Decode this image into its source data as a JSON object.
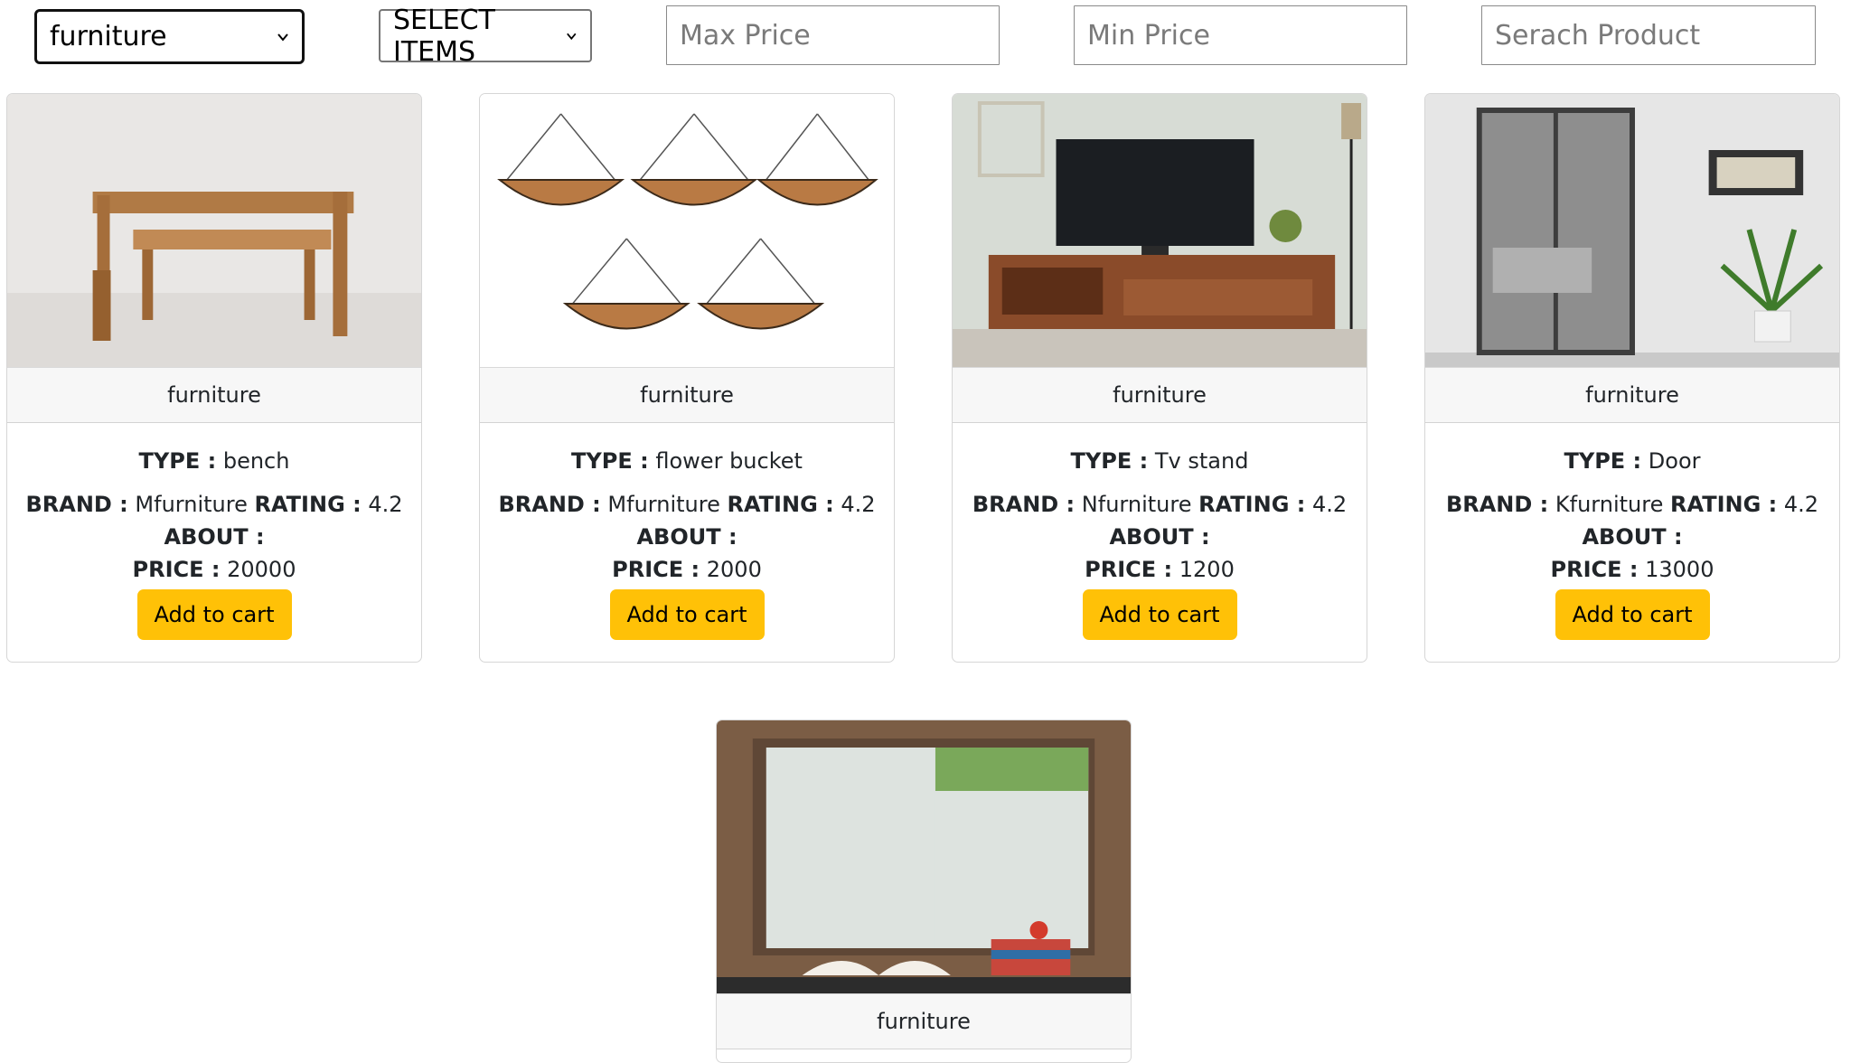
{
  "filters": {
    "category_selected": "furniture",
    "items_selected": "SELECT ITEMS",
    "max_price_placeholder": "Max Price",
    "min_price_placeholder": "Min Price",
    "search_placeholder": "Serach Product"
  },
  "labels": {
    "type": "TYPE :",
    "brand": "BRAND :",
    "rating": "RATING :",
    "about": "ABOUT :",
    "price": "PRICE :",
    "add_to_cart": "Add to cart"
  },
  "products": [
    {
      "category": "furniture",
      "type": "bench",
      "brand": "Mfurniture",
      "rating": "4.2",
      "price": "20000",
      "image": "wooden-bench"
    },
    {
      "category": "furniture",
      "type": "flower bucket",
      "brand": "Mfurniture",
      "rating": "4.2",
      "price": "2000",
      "image": "hanging-baskets"
    },
    {
      "category": "furniture",
      "type": "Tv stand",
      "brand": "Nfurniture",
      "rating": "4.2",
      "price": "1200",
      "image": "tv-stand-room"
    },
    {
      "category": "furniture",
      "type": "Door",
      "brand": "Kfurniture",
      "rating": "4.2",
      "price": "13000",
      "image": "glass-door-room"
    },
    {
      "category": "furniture",
      "image": "frosted-window"
    }
  ],
  "colors": {
    "button": "#ffc107",
    "card_header": "#f7f7f7"
  }
}
